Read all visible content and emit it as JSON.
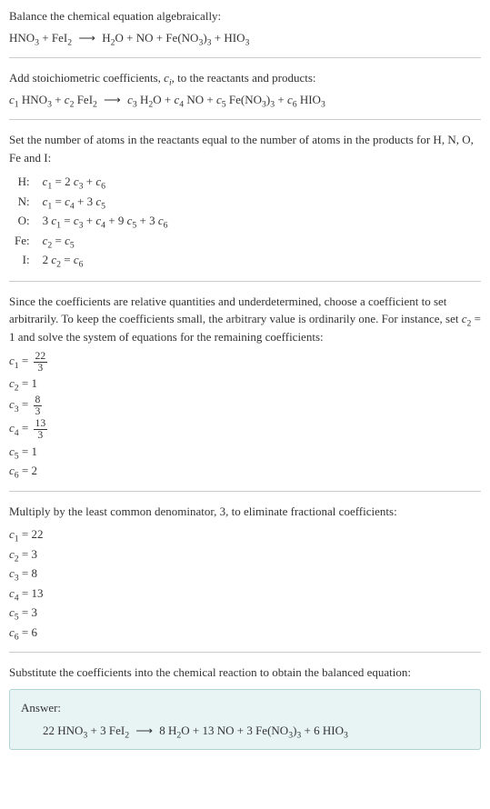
{
  "step1": {
    "text": "Balance the chemical equation algebraically:",
    "eq_lhs1": "HNO",
    "eq_lhs1_sub": "3",
    "eq_plus1": " + FeI",
    "eq_lhs2_sub": "2",
    "eq_arrow": " ⟶ ",
    "eq_rhs1": "H",
    "eq_rhs1_sub": "2",
    "eq_rhs2": "O + NO + Fe(NO",
    "eq_rhs2_sub": "3",
    "eq_rhs3": ")",
    "eq_rhs3_sub": "3",
    "eq_rhs4": " + HIO",
    "eq_rhs4_sub": "3"
  },
  "step2": {
    "text_a": "Add stoichiometric coefficients, ",
    "text_ci": "c",
    "text_ci_sub": "i",
    "text_b": ", to the reactants and products:",
    "c1": "c",
    "c1s": "1",
    "t1": " HNO",
    "t1s": "3",
    "plus1": " + ",
    "c2": "c",
    "c2s": "2",
    "t2": " FeI",
    "t2s": "2",
    "arrow": " ⟶ ",
    "c3": "c",
    "c3s": "3",
    "t3": " H",
    "t3s": "2",
    "t3b": "O + ",
    "c4": "c",
    "c4s": "4",
    "t4": " NO + ",
    "c5": "c",
    "c5s": "5",
    "t5": " Fe(NO",
    "t5s": "3",
    "t5b": ")",
    "t5bs": "3",
    "t5c": " + ",
    "c6": "c",
    "c6s": "6",
    "t6": " HIO",
    "t6s": "3"
  },
  "step3": {
    "text": "Set the number of atoms in the reactants equal to the number of atoms in the products for H, N, O, Fe and I:",
    "rows": {
      "H": {
        "label": "H:",
        "eq_a": "c",
        "eq_as": "1",
        "eq_b": " = 2 ",
        "eq_c": "c",
        "eq_cs": "3",
        "eq_d": " + ",
        "eq_e": "c",
        "eq_es": "6"
      },
      "N": {
        "label": "N:",
        "eq_a": "c",
        "eq_as": "1",
        "eq_b": " = ",
        "eq_c": "c",
        "eq_cs": "4",
        "eq_d": " + 3 ",
        "eq_e": "c",
        "eq_es": "5"
      },
      "O": {
        "label": "O:",
        "eq_a": "3 ",
        "eq_b": "c",
        "eq_bs": "1",
        "eq_c": " = ",
        "eq_d": "c",
        "eq_ds": "3",
        "eq_e": " + ",
        "eq_f": "c",
        "eq_fs": "4",
        "eq_g": " + 9 ",
        "eq_h": "c",
        "eq_hs": "5",
        "eq_i": " + 3 ",
        "eq_j": "c",
        "eq_js": "6"
      },
      "Fe": {
        "label": "Fe:",
        "eq_a": "c",
        "eq_as": "2",
        "eq_b": " = ",
        "eq_c": "c",
        "eq_cs": "5"
      },
      "I": {
        "label": "I:",
        "eq_a": "2 ",
        "eq_b": "c",
        "eq_bs": "2",
        "eq_c": " = ",
        "eq_d": "c",
        "eq_ds": "6"
      }
    }
  },
  "step4": {
    "text_a": "Since the coefficients are relative quantities and underdetermined, choose a coefficient to set arbitrarily. To keep the coefficients small, the arbitrary value is ordinarily one. For instance, set ",
    "text_c": "c",
    "text_cs": "2",
    "text_b": " = 1 and solve the system of equations for the remaining coefficients:",
    "coefs": {
      "c1": {
        "c": "c",
        "s": "1",
        "eq": " = ",
        "num": "22",
        "den": "3"
      },
      "c2": {
        "c": "c",
        "s": "2",
        "eq": " = 1"
      },
      "c3": {
        "c": "c",
        "s": "3",
        "eq": " = ",
        "num": "8",
        "den": "3"
      },
      "c4": {
        "c": "c",
        "s": "4",
        "eq": " = ",
        "num": "13",
        "den": "3"
      },
      "c5": {
        "c": "c",
        "s": "5",
        "eq": " = 1"
      },
      "c6": {
        "c": "c",
        "s": "6",
        "eq": " = 2"
      }
    }
  },
  "step5": {
    "text": "Multiply by the least common denominator, 3, to eliminate fractional coefficients:",
    "coefs": {
      "c1": {
        "c": "c",
        "s": "1",
        "eq": " = 22"
      },
      "c2": {
        "c": "c",
        "s": "2",
        "eq": " = 3"
      },
      "c3": {
        "c": "c",
        "s": "3",
        "eq": " = 8"
      },
      "c4": {
        "c": "c",
        "s": "4",
        "eq": " = 13"
      },
      "c5": {
        "c": "c",
        "s": "5",
        "eq": " = 3"
      },
      "c6": {
        "c": "c",
        "s": "6",
        "eq": " = 6"
      }
    }
  },
  "step6": {
    "text": "Substitute the coefficients into the chemical reaction to obtain the balanced equation:"
  },
  "answer": {
    "label": "Answer:",
    "a": "22 HNO",
    "as": "3",
    "b": " + 3 FeI",
    "bs": "2",
    "arrow": " ⟶ ",
    "c": "8 H",
    "cs": "2",
    "d": "O + 13 NO + 3 Fe(NO",
    "ds": "3",
    "e": ")",
    "es": "3",
    "f": " + 6 HIO",
    "fs": "3"
  }
}
